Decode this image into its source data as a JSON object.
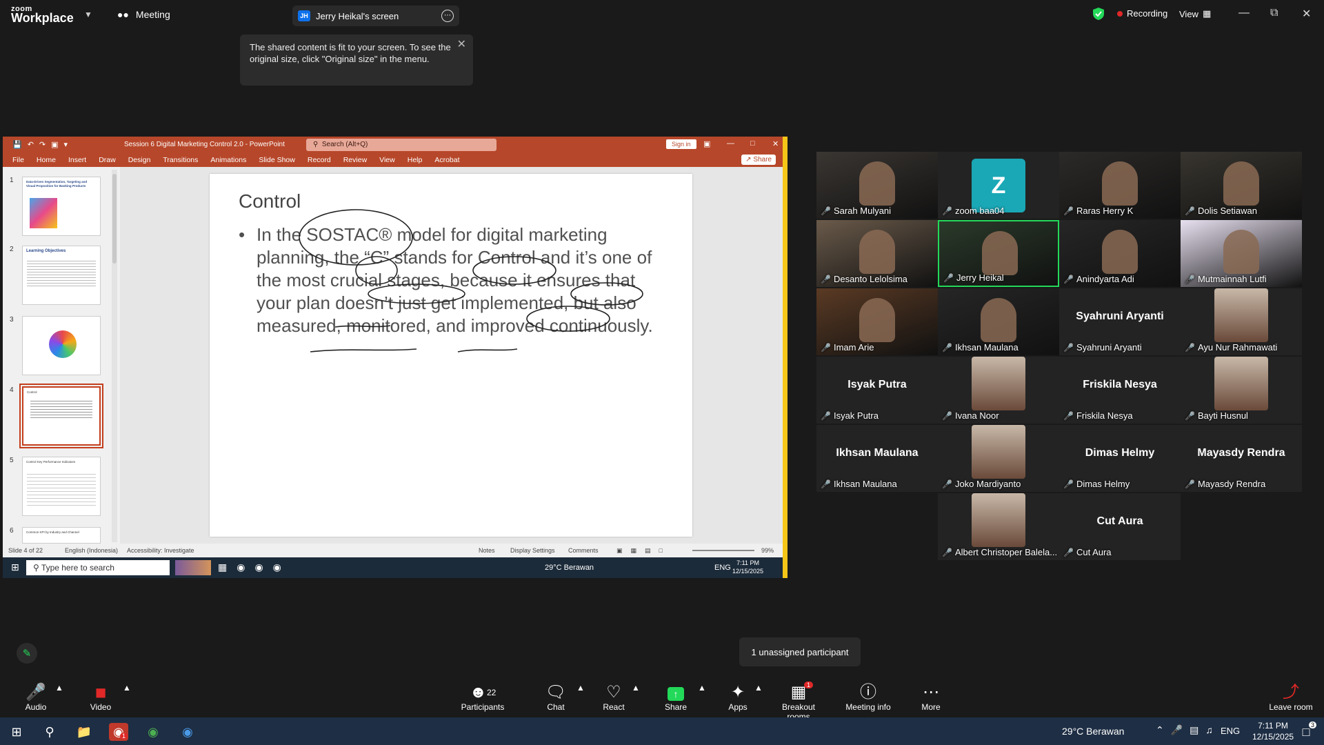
{
  "app": {
    "brand_top": "zoom",
    "brand_bottom": "Workplace",
    "meeting_label": "Meeting",
    "screen_tab": "Jerry Heikal's screen",
    "screen_initials": "JH",
    "recording": "Recording",
    "view": "View"
  },
  "tooltip": {
    "text": "The shared content is fit to your screen. To see the original size, click \"Original size\" in the menu."
  },
  "ppt": {
    "filename": "Session 6 Digital Marketing Control 2.0  -  PowerPoint",
    "search": "Search (Alt+Q)",
    "signin": "Sign in",
    "share": "Share",
    "ribbon": [
      "File",
      "Home",
      "Insert",
      "Draw",
      "Design",
      "Transitions",
      "Animations",
      "Slide Show",
      "Record",
      "Review",
      "View",
      "Help",
      "Acrobat"
    ],
    "thumbs": [
      {
        "num": "1",
        "text": "Data-Driven Segmentation, Targeting and Visual Proposition for Banking Products"
      },
      {
        "num": "2",
        "text": "Learning Objectives"
      },
      {
        "num": "3",
        "text": "SOSTAC"
      },
      {
        "num": "4",
        "text": "Control"
      },
      {
        "num": "5",
        "text": "Control Key Performance Indicators"
      },
      {
        "num": "6",
        "text": "Common KPI by Industry and Channel"
      }
    ],
    "slide_title": "Control",
    "slide_body": "In the SOSTAC® model for digital marketing planning, the “C” stands for Control and it’s one of the most crucial stages, because it ensures that your plan doesn’t just get implemented, but also measured, monitored, and improved continuously.",
    "status": {
      "slide": "Slide 4 of 22",
      "lang": "English (Indonesia)",
      "access": "Accessibility: Investigate",
      "notes": "Notes",
      "display": "Display Settings",
      "comments": "Comments",
      "zoom": "99%"
    },
    "taskbar": {
      "search": "Type here to search",
      "weather": "29°C  Berawan",
      "lang": "ENG",
      "time": "7:11 PM",
      "date": "12/15/2025"
    }
  },
  "participants": [
    {
      "name": "Sarah Mulyani",
      "type": "video"
    },
    {
      "name": "zoom baa04",
      "type": "avatar",
      "initial": "Z"
    },
    {
      "name": "Raras Herry K",
      "type": "video"
    },
    {
      "name": "Dolis Setiawan",
      "type": "video"
    },
    {
      "name": "Desanto Lelolsima",
      "type": "video"
    },
    {
      "name": "Jerry Heikal",
      "type": "video",
      "active": true
    },
    {
      "name": "Anindyarta Adi",
      "type": "video"
    },
    {
      "name": "Mutmainnah Lutfi",
      "type": "video"
    },
    {
      "name": "Imam Arie",
      "type": "video"
    },
    {
      "name": "Ikhsan Maulana",
      "type": "video"
    },
    {
      "name": "Syahruni Aryanti",
      "type": "text"
    },
    {
      "name": "Ayu Nur Rahmawati",
      "type": "photo"
    },
    {
      "name": "Isyak Putra",
      "type": "text"
    },
    {
      "name": "Ivana Noor",
      "type": "photo"
    },
    {
      "name": "Friskila Nesya",
      "type": "text"
    },
    {
      "name": "Bayti Husnul",
      "type": "photo"
    },
    {
      "name": "Ikhsan Maulana",
      "type": "text"
    },
    {
      "name": "Joko Mardiyanto",
      "type": "photo"
    },
    {
      "name": "Dimas Helmy",
      "type": "text"
    },
    {
      "name": "Mayasdy Rendra",
      "type": "text"
    },
    {
      "name": "Albert Christoper Balela...",
      "type": "photo"
    },
    {
      "name": "Cut Aura",
      "type": "text"
    }
  ],
  "unassigned": "1 unassigned participant",
  "toolbar": {
    "audio": "Audio",
    "video": "Video",
    "participants": "Participants",
    "participants_count": "22",
    "chat": "Chat",
    "react": "React",
    "share": "Share",
    "apps": "Apps",
    "breakout": "Breakout rooms",
    "breakout_badge": "1",
    "info": "Meeting info",
    "more": "More",
    "leave": "Leave room"
  },
  "windows": {
    "weather": "29°C  Berawan",
    "lang": "ENG",
    "time": "7:11 PM",
    "date": "12/15/2025",
    "notif": "3",
    "chrome_badge": "1"
  },
  "colors": {
    "zoom_blue": "#0e71eb",
    "ppt_red": "#b7472a",
    "active_green": "#23d959",
    "mute_red": "#e02828",
    "share_green": "#23d959"
  }
}
